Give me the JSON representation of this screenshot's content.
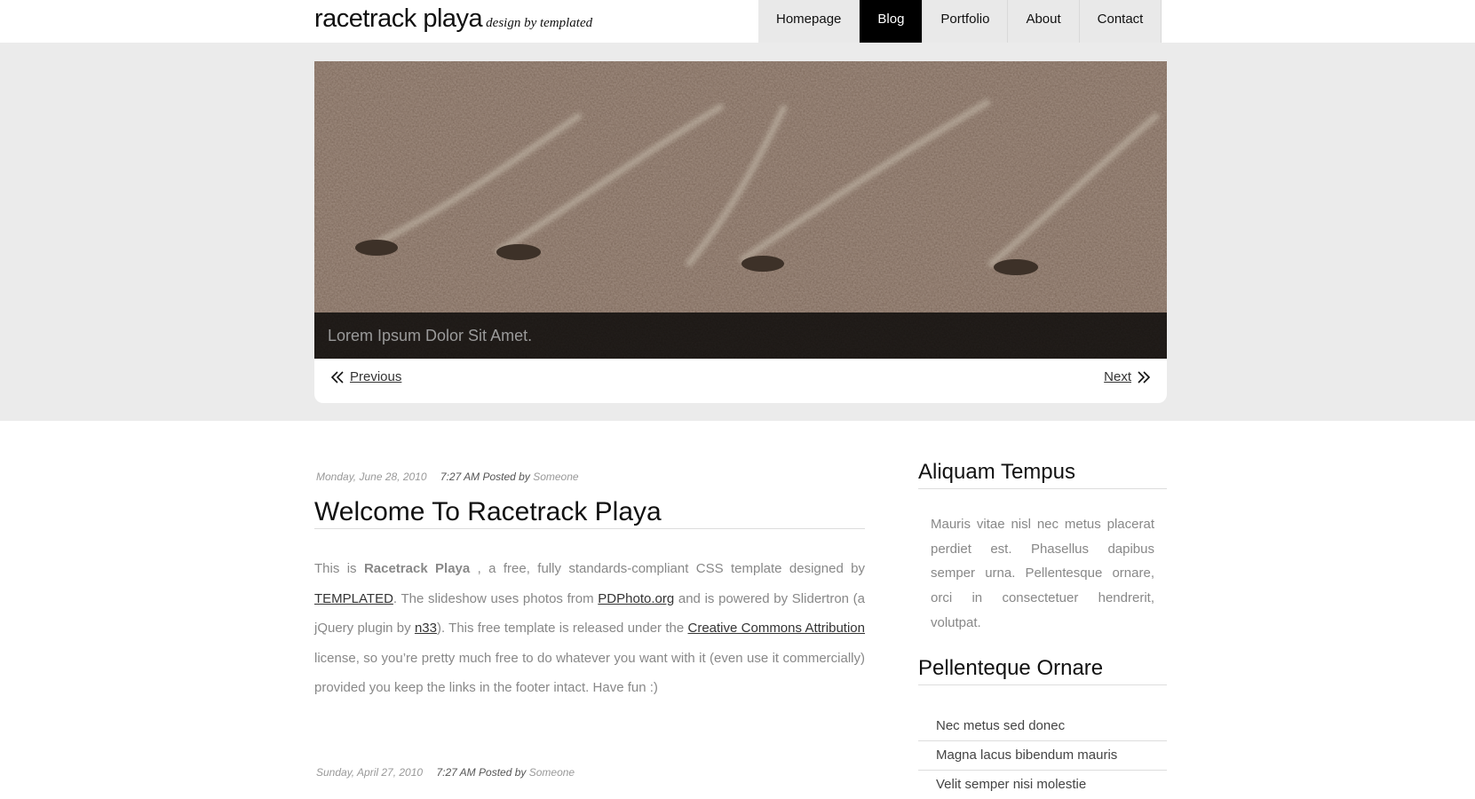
{
  "site": {
    "title": "racetrack playa",
    "tagline": "design by templated"
  },
  "nav": {
    "items": [
      "Homepage",
      "Blog",
      "Portfolio",
      "About",
      "Contact"
    ],
    "active": "Blog"
  },
  "slider": {
    "image": "desert-ground-with-trails",
    "caption": "Lorem Ipsum Dolor Sit Amet.",
    "previous_label": "Previous",
    "next_label": "Next"
  },
  "posts": [
    {
      "date": "Monday, June 28, 2010",
      "time_posted": "7:27 AM Posted by",
      "author": "Someone",
      "title": "Welcome To Racetrack Playa",
      "body": {
        "t1": "This is",
        "site_name": "Racetrack Playa",
        "t2": ", a free, fully standards-compliant CSS template designed by",
        "link1": "TEMPLATED",
        "t3": ". The slideshow uses photos from",
        "link2": "PDPhoto.org",
        "t4": "and is powered by Slidertron (a jQuery plugin by",
        "link3": "n33",
        "t5": "). This free template is released under the",
        "link4": "Creative Commons Attribution",
        "t6": "license, so you’re pretty much free to do whatever you want with it (even use it commercially) provided you keep the links in the footer intact. Have fun :)"
      }
    },
    {
      "date": "Sunday, April 27, 2010",
      "time_posted": "7:27 AM Posted by",
      "author": "Someone"
    }
  ],
  "sidebar": {
    "section1": {
      "title": "Aliquam Tempus",
      "text": "Mauris vitae nisl nec metus placerat perdiet est. Phasellus dapibus semper urna. Pellentesque ornare, orci in consectetuer hendrerit, volutpat."
    },
    "section2": {
      "title": "Pellenteque Ornare",
      "items": [
        "Nec metus sed donec",
        "Magna lacus bibendum mauris",
        "Velit semper nisi molestie"
      ]
    }
  }
}
